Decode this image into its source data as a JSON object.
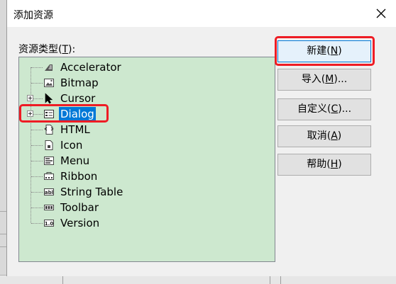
{
  "dialog": {
    "title": "添加资源",
    "close_glyph": "✕",
    "list_label_prefix": "资源类型(",
    "list_label_key": "T",
    "list_label_suffix": "):"
  },
  "tree_items": [
    {
      "label": "Accelerator",
      "icon": "accelerator-icon",
      "expandable": false,
      "selected": false
    },
    {
      "label": "Bitmap",
      "icon": "bitmap-icon",
      "expandable": false,
      "selected": false
    },
    {
      "label": "Cursor",
      "icon": "cursor-icon",
      "expandable": true,
      "selected": false
    },
    {
      "label": "Dialog",
      "icon": "dialog-icon",
      "expandable": true,
      "selected": true
    },
    {
      "label": "HTML",
      "icon": "html-icon",
      "expandable": false,
      "selected": false
    },
    {
      "label": "Icon",
      "icon": "icon-resource-icon",
      "expandable": false,
      "selected": false
    },
    {
      "label": "Menu",
      "icon": "menu-icon",
      "expandable": false,
      "selected": false
    },
    {
      "label": "Ribbon",
      "icon": "ribbon-icon",
      "expandable": false,
      "selected": false
    },
    {
      "label": "String Table",
      "icon": "string-table-icon",
      "expandable": false,
      "selected": false
    },
    {
      "label": "Toolbar",
      "icon": "toolbar-icon",
      "expandable": false,
      "selected": false
    },
    {
      "label": "Version",
      "icon": "version-icon",
      "expandable": false,
      "selected": false
    }
  ],
  "buttons": {
    "new": {
      "prefix": "新建(",
      "key": "N",
      "suffix": ")"
    },
    "import": {
      "prefix": "导入(",
      "key": "M",
      "suffix": ")..."
    },
    "custom": {
      "prefix": "自定义(",
      "key": "C",
      "suffix": ")..."
    },
    "cancel": {
      "prefix": "取消(",
      "key": "A",
      "suffix": ")"
    },
    "help": {
      "prefix": "帮助(",
      "key": "H",
      "suffix": ")"
    }
  },
  "colors": {
    "tree_background": "#cde8cf",
    "selection": "#0078d7",
    "highlight_annotation": "#ee1c24"
  }
}
